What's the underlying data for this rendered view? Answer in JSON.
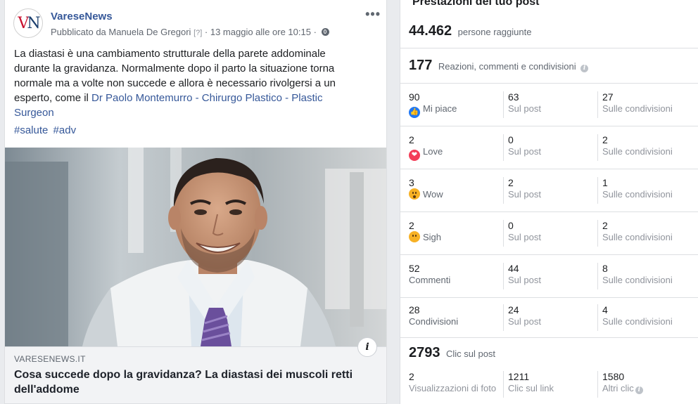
{
  "post": {
    "avatar_letters": "VN",
    "page_name": "VareseNews",
    "byline": {
      "author": "Pubblicato da Manuela De Gregori",
      "help": "[?]",
      "date": " · 13 maggio alle ore 10:15 · "
    },
    "more_label": "•••",
    "text_before_link": "La diastasi è una cambiamento strutturale della parete addominale durante la gravidanza. Normalmente dopo il parto la situazione torna normale ma a volte non succede e allora è necessario rivolgersi a un esperto, come il ",
    "text_link": "Dr Paolo Montemurro - Chirurgo Plastico - Plastic Surgeon",
    "hashtags": [
      "#salute",
      "#adv"
    ],
    "link_preview": {
      "domain": "VARESENEWS.IT",
      "title": "Cosa succede dopo la gravidanza? La diastasi dei muscoli retti dell'addome",
      "info_label": "i"
    }
  },
  "insights": {
    "title": "Prestazioni del tuo post",
    "reach": {
      "value": "44.462",
      "label": "persone raggiunte"
    },
    "engagement": {
      "value": "177",
      "label": "Reazioni, commenti e condivisioni"
    },
    "rows": [
      {
        "total": "90",
        "label": "Mi piace",
        "icon": "like-icon",
        "on_post": "63",
        "on_post_label": "Sul post",
        "on_shares": "27",
        "on_shares_label": "Sulle condivisioni"
      },
      {
        "total": "2",
        "label": "Love",
        "icon": "love-icon",
        "on_post": "0",
        "on_post_label": "Sul post",
        "on_shares": "2",
        "on_shares_label": "Sulle condivisioni"
      },
      {
        "total": "3",
        "label": "Wow",
        "icon": "wow-icon",
        "on_post": "2",
        "on_post_label": "Sul post",
        "on_shares": "1",
        "on_shares_label": "Sulle condivisioni"
      },
      {
        "total": "2",
        "label": "Sigh",
        "icon": "sad-icon",
        "on_post": "0",
        "on_post_label": "Sul post",
        "on_shares": "2",
        "on_shares_label": "Sulle condivisioni"
      },
      {
        "total": "52",
        "label": "Commenti",
        "icon": "",
        "on_post": "44",
        "on_post_label": "Sul post",
        "on_shares": "8",
        "on_shares_label": "Sulle condivisioni"
      },
      {
        "total": "28",
        "label": "Condivisioni",
        "icon": "",
        "on_post": "24",
        "on_post_label": "Sul post",
        "on_shares": "4",
        "on_shares_label": "Sulle condivisioni"
      }
    ],
    "clicks": {
      "value": "2793",
      "label": "Clic sul post"
    },
    "click_breakdown": [
      {
        "value": "2",
        "label": "Visualizzazioni di foto"
      },
      {
        "value": "1211",
        "label": "Clic sul link"
      },
      {
        "value": "1580",
        "label": "Altri clic"
      }
    ],
    "info_glyph": "i"
  },
  "colors": {
    "link_blue": "#365899",
    "like_blue": "#2078f4",
    "love_red": "#f33e58",
    "wow_yellow": "#f7b125"
  }
}
